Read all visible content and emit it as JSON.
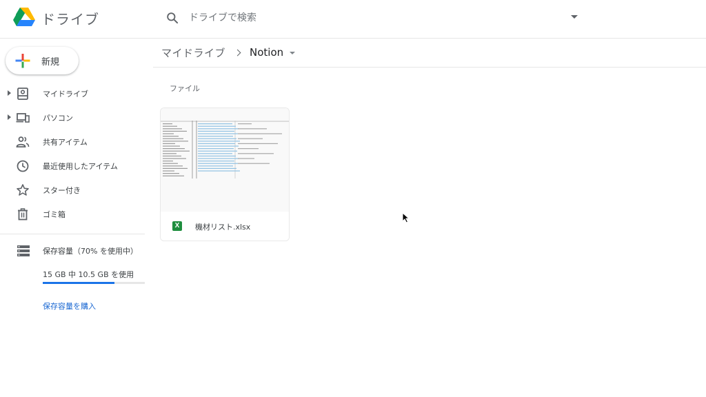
{
  "header": {
    "app_title": "ドライブ",
    "search_placeholder": "ドライブで検索"
  },
  "new_button": {
    "label": "新規"
  },
  "sidebar": {
    "items": [
      {
        "label": "マイドライブ",
        "icon": "my-drive-icon",
        "expandable": true
      },
      {
        "label": "パソコン",
        "icon": "computers-icon",
        "expandable": true
      },
      {
        "label": "共有アイテム",
        "icon": "shared-icon",
        "expandable": false
      },
      {
        "label": "最近使用したアイテム",
        "icon": "clock-icon",
        "expandable": false
      },
      {
        "label": "スター付き",
        "icon": "star-icon",
        "expandable": false
      },
      {
        "label": "ゴミ箱",
        "icon": "trash-icon",
        "expandable": false
      }
    ],
    "storage": {
      "title": "保存容量（70% を使用中）",
      "usage": "15 GB 中 10.5 GB を使用",
      "percent_used": 70,
      "buy_link": "保存容量を購入"
    }
  },
  "breadcrumb": {
    "root": "マイドライブ",
    "current": "Notion"
  },
  "main": {
    "section_label": "ファイル",
    "files": [
      {
        "name": "機材リスト.xlsx",
        "type_icon": "excel-icon",
        "type_letter": "X"
      }
    ]
  },
  "colors": {
    "accent": "#1a73e8",
    "link": "#1967d2",
    "excel_green": "#1e8e3e"
  }
}
